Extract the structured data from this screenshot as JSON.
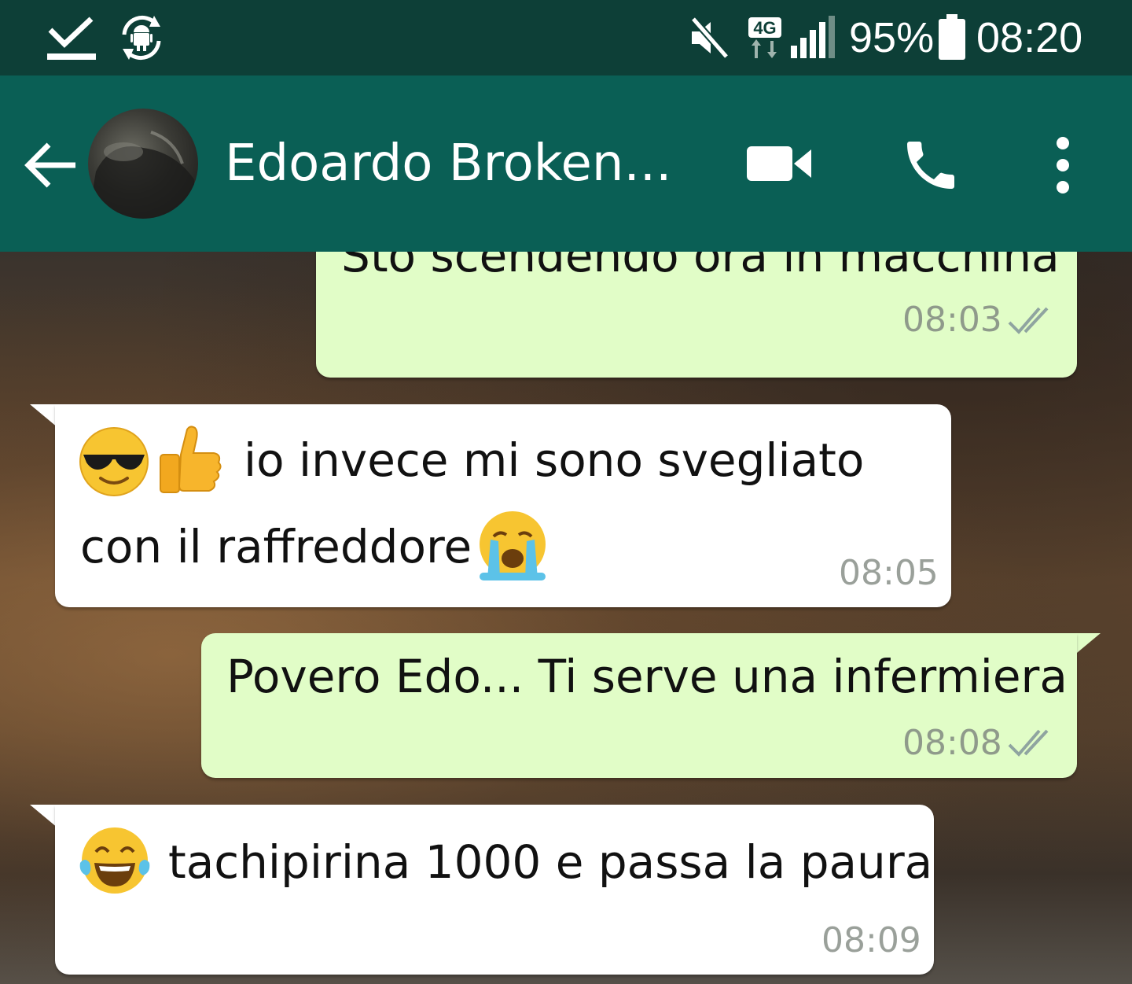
{
  "status_bar": {
    "battery_percent": "95%",
    "time": "08:20",
    "network_type": "4G",
    "icons": [
      "download-done-icon",
      "android-sync-icon",
      "mute-icon",
      "network-4g-icon",
      "signal-icon",
      "battery-icon"
    ]
  },
  "header": {
    "contact_name": "Edoardo Broken...",
    "icons": [
      "back-arrow-icon",
      "avatar",
      "video-call-icon",
      "phone-icon",
      "more-options-icon"
    ]
  },
  "colors": {
    "status_bar": "#0d3f37",
    "app_bar": "#0a5f55",
    "outgoing_bubble": "#e1fdc7",
    "incoming_bubble": "#ffffff",
    "timestamp": "#8f9a8b"
  },
  "messages": [
    {
      "direction": "outgoing",
      "text": "Sto scendendo ora in macchina",
      "time": "08:03",
      "status": "read"
    },
    {
      "direction": "incoming",
      "emojis_prefix": [
        "sunglasses-emoji",
        "thumbs-up-emoji"
      ],
      "line1": "io invece mi sono svegliato",
      "line2": "con il raffreddore",
      "emojis_suffix": [
        "crying-emoji"
      ],
      "time": "08:05"
    },
    {
      "direction": "outgoing",
      "text": "Povero Edo... Ti serve una infermiera",
      "time": "08:08",
      "status": "read"
    },
    {
      "direction": "incoming",
      "emojis_prefix": [
        "tears-of-joy-emoji"
      ],
      "text": "tachipirina 1000 e passa la paura",
      "time": "08:09"
    }
  ]
}
